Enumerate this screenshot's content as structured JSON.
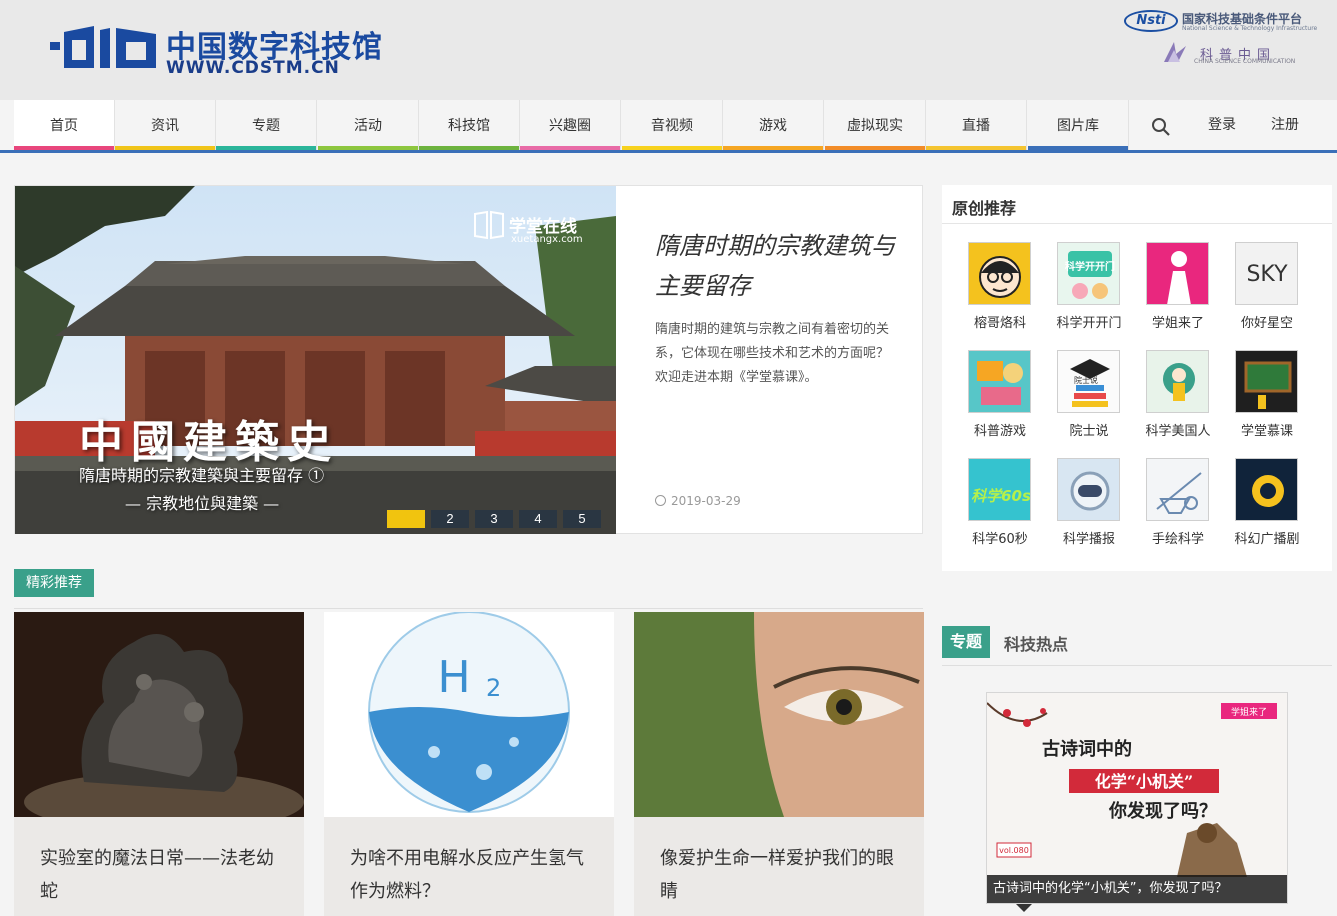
{
  "header": {
    "logo_cn": "中国数字科技馆",
    "logo_en": "WWW.CDSTM.CN",
    "partner1_badge": "Nsti",
    "partner1_cn": "国家科技基础条件平台",
    "partner1_en": "National Science & Technology Infrastructure",
    "partner2_cn": "科普中国",
    "partner2_en": "CHINA SCIENCE COMMUNICATION"
  },
  "nav": {
    "items": [
      {
        "label": "首页",
        "color": "#e8467c"
      },
      {
        "label": "资讯",
        "color": "#f0c419"
      },
      {
        "label": "专题",
        "color": "#2bb59a"
      },
      {
        "label": "活动",
        "color": "#8dc63f"
      },
      {
        "label": "科技馆",
        "color": "#6db33f"
      },
      {
        "label": "兴趣圈",
        "color": "#e86ba6"
      },
      {
        "label": "音视频",
        "color": "#f7d21e"
      },
      {
        "label": "游戏",
        "color": "#f5a623"
      },
      {
        "label": "虚拟现实",
        "color": "#f28c28"
      },
      {
        "label": "直播",
        "color": "#f4c430"
      },
      {
        "label": "图片库",
        "color": "#3a6fb8"
      }
    ],
    "login": "登录",
    "register": "注册"
  },
  "carousel": {
    "title": "隋唐时期的宗教建筑与主要留存",
    "description": "隋唐时期的建筑与宗教之间有着密切的关系，它体现在哪些技术和艺术的方面呢？欢迎走进本期《学堂慕课》。",
    "date": "2019-03-29",
    "image_title": "中國建築史",
    "image_subtitle": "隋唐時期的宗教建築與主要留存 ①",
    "image_subtitle2": "— 宗教地位與建築 —",
    "watermark_cn": "学堂在线",
    "watermark_en": "xuetangx.com",
    "pages": [
      "1",
      "2",
      "3",
      "4",
      "5"
    ],
    "active_page": 1
  },
  "recommend": {
    "title": "原创推荐",
    "items": [
      {
        "label": "榕哥烙科"
      },
      {
        "label": "科学开开门"
      },
      {
        "label": "学姐来了"
      },
      {
        "label": "你好星空"
      },
      {
        "label": "科普游戏"
      },
      {
        "label": "院士说"
      },
      {
        "label": "科学美国人"
      },
      {
        "label": "学堂慕课"
      },
      {
        "label": "科学60秒"
      },
      {
        "label": "科学播报"
      },
      {
        "label": "手绘科学"
      },
      {
        "label": "科幻广播剧"
      }
    ],
    "thumb_texts": {
      "sky": "SKY",
      "kxkkm": "科学开开门",
      "s60": "科学60s",
      "ysh": "院士说"
    }
  },
  "featured": {
    "tag": "精彩推荐",
    "cards": [
      {
        "title": "实验室的魔法日常——法老幼蛇"
      },
      {
        "title": "为啥不用电解水反应产生氢气作为燃料？"
      },
      {
        "title": "像爱护生命一样爱护我们的眼睛"
      }
    ],
    "h2_text": "H",
    "h2_sub": "2"
  },
  "topic": {
    "tag": "专题",
    "hot": "科技热点",
    "poster_line1": "古诗词中的",
    "poster_line2": "化学“小机关”",
    "poster_line3": "你发现了吗？",
    "poster_badge": "学姐来了",
    "poster_vol": "vol.080",
    "caption": "古诗词中的化学“小机关”，你发现了吗？"
  }
}
